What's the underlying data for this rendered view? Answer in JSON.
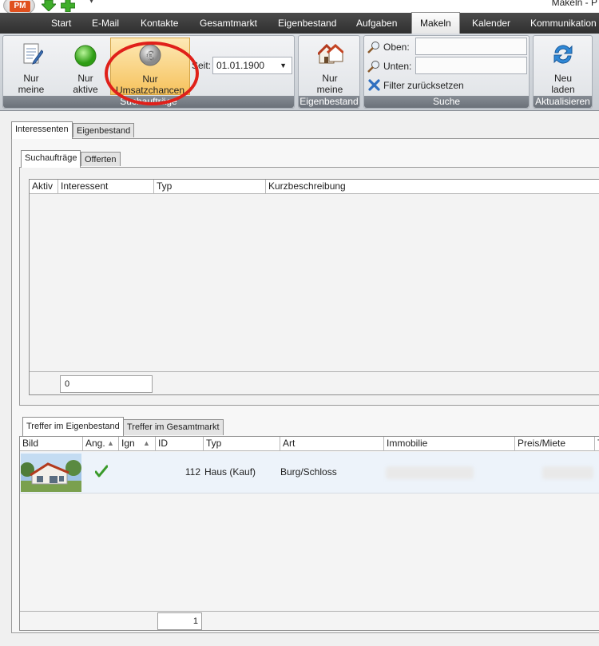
{
  "window": {
    "title": "Makeln - P"
  },
  "app": {
    "logo_text": "PM"
  },
  "ribbon_tabs": [
    "Start",
    "E-Mail",
    "Kontakte",
    "Gesamtmarkt",
    "Eigenbestand",
    "Aufgaben",
    "Makeln",
    "Kalender",
    "Kommunikation"
  ],
  "active_ribbon_tab": "Makeln",
  "ribbon": {
    "suchauftraege": {
      "label": "Suchaufträge",
      "btn_nur_meine": "Nur\nmeine",
      "btn_nur_aktive": "Nur\naktive",
      "btn_nur_umsatzchancen": "Nur\nUmsatzchancen",
      "seit_label": "Seit:",
      "seit_value": "01.01.1900"
    },
    "eigenbestand": {
      "label": "Eigenbestand",
      "btn_nur_meine": "Nur\nmeine"
    },
    "suche": {
      "label": "Suche",
      "oben_label": "Oben:",
      "unten_label": "Unten:",
      "reset_label": "Filter zurücksetzen"
    },
    "aktualisieren": {
      "label": "Aktualisieren",
      "btn_neu_laden": "Neu\nladen"
    }
  },
  "main_tabs": [
    "Interessenten",
    "Eigenbestand"
  ],
  "sub_tabs": [
    "Suchaufträge",
    "Offerten"
  ],
  "grid1": {
    "columns": [
      "Aktiv",
      "Interessent",
      "Typ",
      "Kurzbeschreibung"
    ],
    "count": "0"
  },
  "result_tabs": [
    "Treffer im Eigenbestand",
    "Treffer im Gesamtmarkt"
  ],
  "grid2": {
    "columns": [
      "Bild",
      "Ang.",
      "Ign",
      "ID",
      "Typ",
      "Art",
      "Immobilie",
      "Preis/Miete",
      "T"
    ],
    "rows": [
      {
        "id": "112",
        "typ": "Haus (Kauf)",
        "art": "Burg/Schloss",
        "angeboten": true
      }
    ],
    "count": "1"
  },
  "colors": {
    "accent": "#f6c25c",
    "highlight_circle": "#e0201a",
    "ribbon_dark": "#3a3a3a"
  }
}
